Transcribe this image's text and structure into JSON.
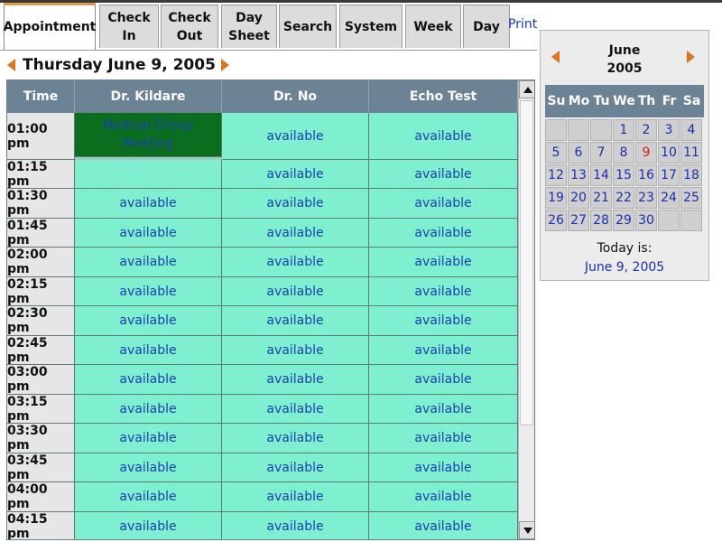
{
  "tabs": [
    {
      "label": "Appointment",
      "active": true
    },
    {
      "label": "Check\nIn",
      "active": false
    },
    {
      "label": "Check\nOut",
      "active": false
    },
    {
      "label": "Day\nSheet",
      "active": false
    },
    {
      "label": "Search",
      "active": false
    },
    {
      "label": "System",
      "active": false
    },
    {
      "label": "Week",
      "active": false
    },
    {
      "label": "Day",
      "active": false
    }
  ],
  "print_label": "Print",
  "day_header": {
    "title": "Thursday June 9, 2005"
  },
  "schedule": {
    "columns": [
      "Time",
      "Dr. Kildare",
      "Dr. No",
      "Echo Test"
    ],
    "rows": [
      {
        "time": "01:00 pm",
        "cells": [
          "Medical Group\nMeeting",
          "available",
          "available"
        ]
      },
      {
        "time": "01:15 pm",
        "cells": [
          "",
          "available",
          "available"
        ]
      },
      {
        "time": "01:30 pm",
        "cells": [
          "available",
          "available",
          "available"
        ]
      },
      {
        "time": "01:45 pm",
        "cells": [
          "available",
          "available",
          "available"
        ]
      },
      {
        "time": "02:00 pm",
        "cells": [
          "available",
          "available",
          "available"
        ]
      },
      {
        "time": "02:15 pm",
        "cells": [
          "available",
          "available",
          "available"
        ]
      },
      {
        "time": "02:30 pm",
        "cells": [
          "available",
          "available",
          "available"
        ]
      },
      {
        "time": "02:45 pm",
        "cells": [
          "available",
          "available",
          "available"
        ]
      },
      {
        "time": "03:00 pm",
        "cells": [
          "available",
          "available",
          "available"
        ]
      },
      {
        "time": "03:15 pm",
        "cells": [
          "available",
          "available",
          "available"
        ]
      },
      {
        "time": "03:30 pm",
        "cells": [
          "available",
          "available",
          "available"
        ]
      },
      {
        "time": "03:45 pm",
        "cells": [
          "available",
          "available",
          "available"
        ]
      },
      {
        "time": "04:00 pm",
        "cells": [
          "available",
          "available",
          "available"
        ]
      },
      {
        "time": "04:15 pm",
        "cells": [
          "available",
          "available",
          "available"
        ]
      }
    ]
  },
  "calendar": {
    "month": "June",
    "year": "2005",
    "weekdays": [
      "Su",
      "Mo",
      "Tu",
      "We",
      "Th",
      "Fr",
      "Sa"
    ],
    "weeks": [
      [
        "",
        "",
        "",
        "1",
        "2",
        "3",
        "4"
      ],
      [
        "5",
        "6",
        "7",
        "8",
        "9",
        "10",
        "11"
      ],
      [
        "12",
        "13",
        "14",
        "15",
        "16",
        "17",
        "18"
      ],
      [
        "19",
        "20",
        "21",
        "22",
        "23",
        "24",
        "25"
      ],
      [
        "26",
        "27",
        "28",
        "29",
        "30",
        "",
        ""
      ]
    ],
    "selected_day": "9",
    "today_label": "Today is:",
    "today_value": "June 9, 2005"
  },
  "colors": {
    "header_bg": "#6b8395",
    "slot_bg": "#7ff0cf",
    "meeting_bg": "#0a6e1e",
    "link_blue": "#1a3fb0",
    "arrow_orange": "#e2751c",
    "today_red": "#d22020"
  }
}
